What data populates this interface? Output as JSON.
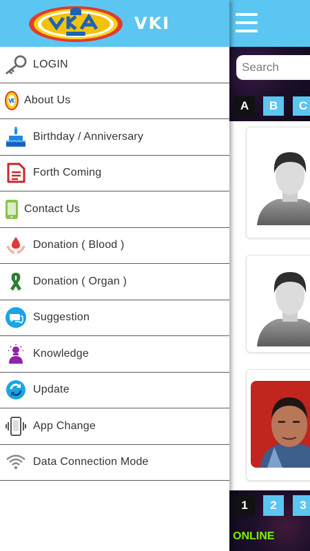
{
  "drawer": {
    "brand": "VKI",
    "logo_text": "VKA",
    "items": [
      {
        "label": "LOGIN",
        "icon": "key-icon"
      },
      {
        "label": "About Us",
        "icon": "about-logo-icon"
      },
      {
        "label": "Birthday / Anniversary",
        "icon": "cake-icon"
      },
      {
        "label": "Forth Coming",
        "icon": "document-icon"
      },
      {
        "label": "Contact Us",
        "icon": "phone-icon"
      },
      {
        "label": "Donation ( Blood )",
        "icon": "blood-drop-hands-icon"
      },
      {
        "label": "Donation ( Organ )",
        "icon": "ribbon-icon"
      },
      {
        "label": "Suggestion",
        "icon": "chat-bubbles-icon"
      },
      {
        "label": "Knowledge",
        "icon": "idea-person-icon"
      },
      {
        "label": "Update",
        "icon": "refresh-icon"
      },
      {
        "label": "App Change",
        "icon": "mobile-vibrate-icon"
      },
      {
        "label": "Data Connection Mode",
        "icon": "wifi-icon"
      }
    ]
  },
  "main": {
    "search_placeholder": "Search",
    "alphabet": [
      "A",
      "B",
      "C"
    ],
    "pages": [
      "1",
      "2",
      "3"
    ],
    "status": "ONLINE"
  },
  "colors": {
    "header": "#5bc6f1",
    "active_chip": "#111111",
    "status_text": "#7cf000"
  }
}
